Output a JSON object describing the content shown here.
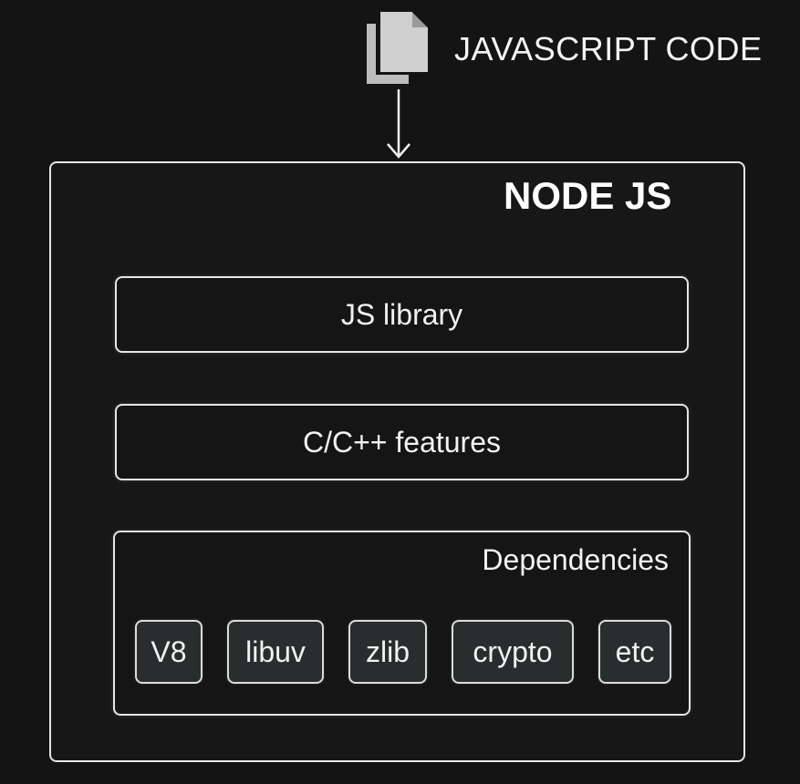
{
  "source": {
    "label": "JAVASCRIPT CODE",
    "icon": "copy-files-icon"
  },
  "node": {
    "title": "NODE JS",
    "layers": [
      {
        "label": "JS library"
      },
      {
        "label": "C/C++ features"
      }
    ],
    "dependencies": {
      "title": "Dependencies",
      "items": [
        "V8",
        "libuv",
        "zlib",
        "crypto",
        "etc"
      ]
    }
  },
  "colors": {
    "background": "#141414",
    "border": "#e6e6e6",
    "chip_fill": "#2a2d2e",
    "text": "#f2f2f2",
    "icon": "#c8c8c8"
  }
}
